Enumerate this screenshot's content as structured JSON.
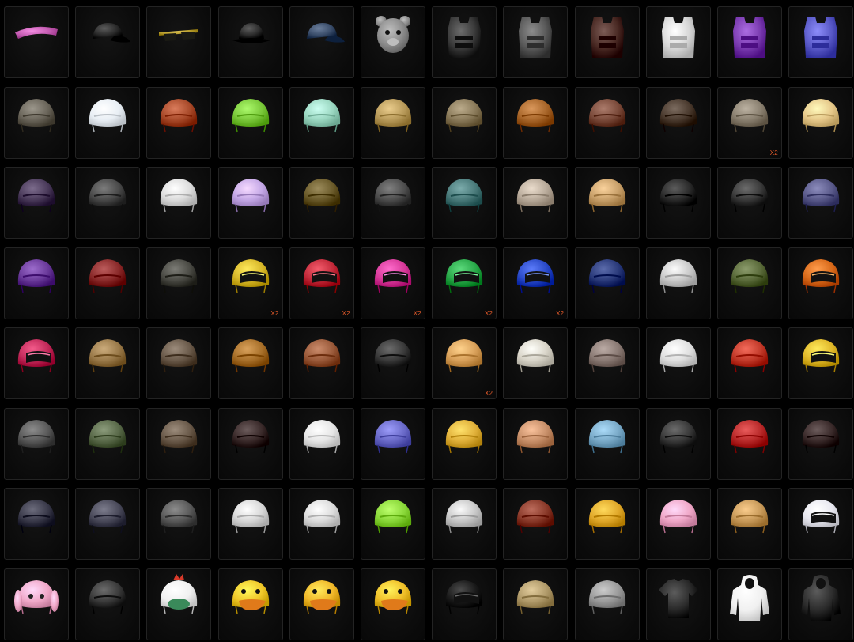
{
  "inventory": {
    "items": [
      {
        "icon": "visor-icon",
        "color": "#c25bb0",
        "count": ""
      },
      {
        "icon": "cap-icon",
        "color": "#2a2a2a",
        "count": ""
      },
      {
        "icon": "sunglasses-icon",
        "color": "#b49a2a",
        "count": ""
      },
      {
        "icon": "bucket-hat-icon",
        "color": "#2c2c2c",
        "count": ""
      },
      {
        "icon": "cap-icon",
        "color": "#3a4d6a",
        "count": ""
      },
      {
        "icon": "bear-mask-icon",
        "color": "#8c8c8c",
        "count": ""
      },
      {
        "icon": "vest-icon",
        "color": "#3a3a3a",
        "count": ""
      },
      {
        "icon": "vest-icon",
        "color": "#5a5a5a",
        "count": ""
      },
      {
        "icon": "vest-icon",
        "color": "#4a2a24",
        "count": ""
      },
      {
        "icon": "vest-icon",
        "color": "#d8d8d8",
        "count": ""
      },
      {
        "icon": "vest-icon",
        "color": "#7a3bb0",
        "count": ""
      },
      {
        "icon": "vest-icon",
        "color": "#5a5ac8",
        "count": ""
      },
      {
        "icon": "helmet-icon",
        "color": "#6a655a",
        "count": ""
      },
      {
        "icon": "helmet-icon",
        "color": "#e8eef4",
        "count": ""
      },
      {
        "icon": "helmet-icon",
        "color": "#a84a2a",
        "count": ""
      },
      {
        "icon": "helmet-icon",
        "color": "#7ac83a",
        "count": ""
      },
      {
        "icon": "helmet-icon",
        "color": "#9ad6c0",
        "count": ""
      },
      {
        "icon": "helmet-icon",
        "color": "#b89a5a",
        "count": ""
      },
      {
        "icon": "helmet-icon",
        "color": "#8a7a5a",
        "count": ""
      },
      {
        "icon": "helmet-icon",
        "color": "#a8662a",
        "count": ""
      },
      {
        "icon": "helmet-icon",
        "color": "#7a4a3a",
        "count": ""
      },
      {
        "icon": "helmet-icon",
        "color": "#4a3a2e",
        "count": ""
      },
      {
        "icon": "helmet-icon",
        "color": "#8a8070",
        "count": "X2"
      },
      {
        "icon": "helmet-icon",
        "color": "#e6c88a",
        "count": ""
      },
      {
        "icon": "helmet-icon",
        "color": "#4a3a5a",
        "count": ""
      },
      {
        "icon": "helmet-icon",
        "color": "#4a4a4a",
        "count": ""
      },
      {
        "icon": "helmet-icon",
        "color": "#dcdcdc",
        "count": ""
      },
      {
        "icon": "helmet-icon",
        "color": "#c4a8e6",
        "count": ""
      },
      {
        "icon": "helmet-icon",
        "color": "#6a5a2a",
        "count": ""
      },
      {
        "icon": "helmet-icon",
        "color": "#4e4e4e",
        "count": ""
      },
      {
        "icon": "helmet-icon",
        "color": "#4a7a7a",
        "count": ""
      },
      {
        "icon": "helmet-icon",
        "color": "#b8aa9a",
        "count": ""
      },
      {
        "icon": "helmet-icon",
        "color": "#c8a06a",
        "count": ""
      },
      {
        "icon": "helmet-icon",
        "color": "#2a2a2a",
        "count": ""
      },
      {
        "icon": "helmet-icon",
        "color": "#3a3a3a",
        "count": ""
      },
      {
        "icon": "helmet-icon",
        "color": "#5a5a8a",
        "count": ""
      },
      {
        "icon": "helmet-icon",
        "color": "#6a3a9a",
        "count": ""
      },
      {
        "icon": "helmet-icon",
        "color": "#8a2a2a",
        "count": ""
      },
      {
        "icon": "helmet-icon",
        "color": "#4a4a44",
        "count": ""
      },
      {
        "icon": "racing-helmet-icon",
        "color": "#d8b82a",
        "count": "X2"
      },
      {
        "icon": "racing-helmet-icon",
        "color": "#c22a3a",
        "count": "X2"
      },
      {
        "icon": "racing-helmet-icon",
        "color": "#d83a9a",
        "count": "X2"
      },
      {
        "icon": "racing-helmet-icon",
        "color": "#2aa84a",
        "count": "X2"
      },
      {
        "icon": "racing-helmet-icon",
        "color": "#2a4ac8",
        "count": "X2"
      },
      {
        "icon": "helmet-icon",
        "color": "#2a3a7a",
        "count": ""
      },
      {
        "icon": "helmet-icon",
        "color": "#cacaca",
        "count": ""
      },
      {
        "icon": "helmet-icon",
        "color": "#5a6a3a",
        "count": ""
      },
      {
        "icon": "racing-helmet-icon",
        "color": "#d86a1a",
        "count": ""
      },
      {
        "icon": "racing-helmet-icon",
        "color": "#c22a5a",
        "count": ""
      },
      {
        "icon": "helmet-icon",
        "color": "#9a7a4a",
        "count": ""
      },
      {
        "icon": "helmet-icon",
        "color": "#6a5a4a",
        "count": ""
      },
      {
        "icon": "helmet-icon",
        "color": "#a8702a",
        "count": ""
      },
      {
        "icon": "helmet-icon",
        "color": "#9a5a3a",
        "count": ""
      },
      {
        "icon": "helmet-icon",
        "color": "#3a3a3a",
        "count": ""
      },
      {
        "icon": "helmet-icon",
        "color": "#d8a05a",
        "count": "X2"
      },
      {
        "icon": "helmet-icon",
        "color": "#d8d4c8",
        "count": ""
      },
      {
        "icon": "helmet-icon",
        "color": "#8a7a74",
        "count": ""
      },
      {
        "icon": "helmet-icon",
        "color": "#e0e0e0",
        "count": ""
      },
      {
        "icon": "helmet-icon",
        "color": "#c23a2a",
        "count": ""
      },
      {
        "icon": "racing-helmet-icon",
        "color": "#e0b82a",
        "count": ""
      },
      {
        "icon": "helmet-icon",
        "color": "#5a5a5a",
        "count": ""
      },
      {
        "icon": "helmet-icon",
        "color": "#5a6a4a",
        "count": ""
      },
      {
        "icon": "helmet-icon",
        "color": "#6a5a4a",
        "count": ""
      },
      {
        "icon": "helmet-icon",
        "color": "#3a2a2a",
        "count": ""
      },
      {
        "icon": "helmet-icon",
        "color": "#e6e6e6",
        "count": ""
      },
      {
        "icon": "helmet-icon",
        "color": "#6a6ac8",
        "count": ""
      },
      {
        "icon": "helmet-icon",
        "color": "#e0b03a",
        "count": ""
      },
      {
        "icon": "helmet-icon",
        "color": "#c8906a",
        "count": ""
      },
      {
        "icon": "helmet-icon",
        "color": "#7aaac8",
        "count": ""
      },
      {
        "icon": "helmet-icon",
        "color": "#3a3a3a",
        "count": ""
      },
      {
        "icon": "helmet-icon",
        "color": "#b82a2a",
        "count": ""
      },
      {
        "icon": "helmet-icon",
        "color": "#3a2a2a",
        "count": ""
      },
      {
        "icon": "helmet-icon",
        "color": "#3a3a4a",
        "count": ""
      },
      {
        "icon": "helmet-icon",
        "color": "#4a4a5a",
        "count": ""
      },
      {
        "icon": "helmet-icon",
        "color": "#5a5a5a",
        "count": ""
      },
      {
        "icon": "helmet-icon",
        "color": "#d8d8d8",
        "count": ""
      },
      {
        "icon": "helmet-icon",
        "color": "#dcdcdc",
        "count": ""
      },
      {
        "icon": "helmet-icon",
        "color": "#8ad83a",
        "count": ""
      },
      {
        "icon": "helmet-icon",
        "color": "#c8c8c8",
        "count": ""
      },
      {
        "icon": "helmet-icon",
        "color": "#8a3a2a",
        "count": ""
      },
      {
        "icon": "helmet-icon",
        "color": "#e0a82a",
        "count": ""
      },
      {
        "icon": "helmet-icon",
        "color": "#f0a8c8",
        "count": ""
      },
      {
        "icon": "helmet-icon",
        "color": "#c89a5a",
        "count": ""
      },
      {
        "icon": "racing-helmet-icon",
        "color": "#e8e8f0",
        "count": ""
      },
      {
        "icon": "bunny-helmet-icon",
        "color": "#f0a8c8",
        "count": ""
      },
      {
        "icon": "helmet-icon",
        "color": "#3a3a3a",
        "count": ""
      },
      {
        "icon": "chicken-helmet-icon",
        "color": "#f0f0f0",
        "count": ""
      },
      {
        "icon": "duck-helmet-icon",
        "color": "#f0c82a",
        "count": ""
      },
      {
        "icon": "duck-helmet-icon",
        "color": "#f0b82a",
        "count": ""
      },
      {
        "icon": "duck-helmet-icon",
        "color": "#f0c02a",
        "count": ""
      },
      {
        "icon": "racing-helmet-icon",
        "color": "#1a1a1a",
        "count": ""
      },
      {
        "icon": "helmet-icon",
        "color": "#b09a6a",
        "count": ""
      },
      {
        "icon": "helmet-icon",
        "color": "#9a9a9a",
        "count": ""
      },
      {
        "icon": "tshirt-icon",
        "color": "#2a2a2a",
        "count": ""
      },
      {
        "icon": "hoodie-icon",
        "color": "#f0f0f0",
        "count": ""
      },
      {
        "icon": "hoodie-icon",
        "color": "#2a2a2a",
        "count": ""
      }
    ]
  }
}
